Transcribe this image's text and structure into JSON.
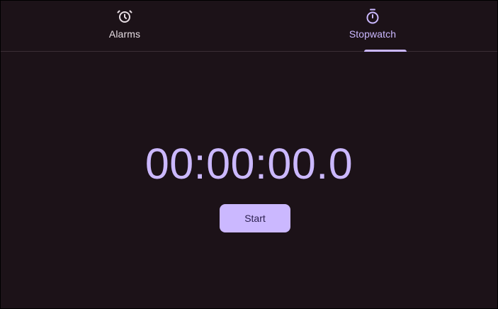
{
  "tabs": [
    {
      "label": "Alarms",
      "icon": "alarm-clock-icon",
      "active": false
    },
    {
      "label": "Stopwatch",
      "icon": "stopwatch-icon",
      "active": true
    }
  ],
  "stopwatch": {
    "time": "00:00:00.0",
    "start_label": "Start"
  },
  "colors": {
    "background": "#1c1218",
    "accent": "#cbb8ff",
    "button_text": "#2b1f4f",
    "inactive_text": "#e6dde3",
    "divider": "#3a2d35"
  }
}
